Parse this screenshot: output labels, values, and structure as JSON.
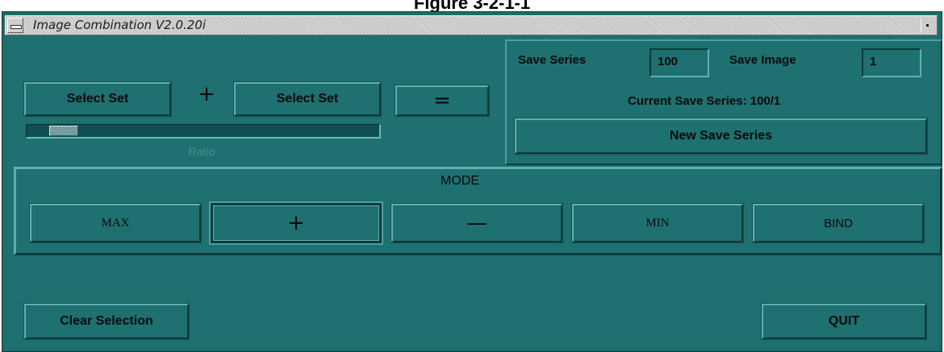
{
  "figure_caption": "Figure 3-2-1-1",
  "window": {
    "title": "Image Combination V2.0.20i"
  },
  "left": {
    "select_set_1": "Select Set",
    "plus_operator": "+",
    "select_set_2": "Select Set",
    "equals": "=",
    "slider": {
      "label": "Ratio",
      "value_fraction": 0.07
    }
  },
  "save": {
    "series_label": "Save Series",
    "series_value": "100",
    "image_label": "Save Image",
    "image_value": "1",
    "current_text": "Current Save Series: 100/1",
    "new_button": "New Save Series"
  },
  "mode": {
    "title": "MODE",
    "buttons": [
      "MAX",
      "+",
      "—",
      "MIN",
      "BIND"
    ],
    "selected": "+"
  },
  "bottom": {
    "clear_button": "Clear Selection",
    "quit_button": "QUIT"
  },
  "colors": {
    "background": "#1f7070",
    "highlight": "#5fb0ae",
    "shadow": "#0b3b3b"
  }
}
